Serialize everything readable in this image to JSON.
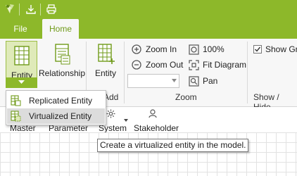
{
  "titlebar": {
    "icons": [
      "app-logo-icon",
      "save-download-icon",
      "print-icon"
    ]
  },
  "tabs": {
    "file": "File",
    "home": "Home"
  },
  "ribbon": {
    "entity_label": "Entity",
    "relationship_label": "Relationship",
    "entity2_label": "Entity",
    "zoom_in": "Zoom In",
    "zoom_out": "Zoom Out",
    "zoom_100": "100%",
    "fit_diagram": "Fit Diagram",
    "pan": "Pan",
    "show_grid": "Show Grid",
    "group_add": "Add",
    "group_zoom": "Zoom",
    "group_show_hide": "Show / Hide"
  },
  "toolbar2": {
    "master": "Master",
    "parameter": "Parameter",
    "system": "System",
    "stakeholder": "Stakeholder"
  },
  "dropdown": {
    "replicated": "Replicated Entity",
    "virtualized": "Virtualized Entity"
  },
  "tooltip": "Create a virtualized entity in the model.",
  "colors": {
    "accent": "#8db82a",
    "accent_dark": "#6f9a18",
    "hover_gray": "#dcdcdc"
  }
}
